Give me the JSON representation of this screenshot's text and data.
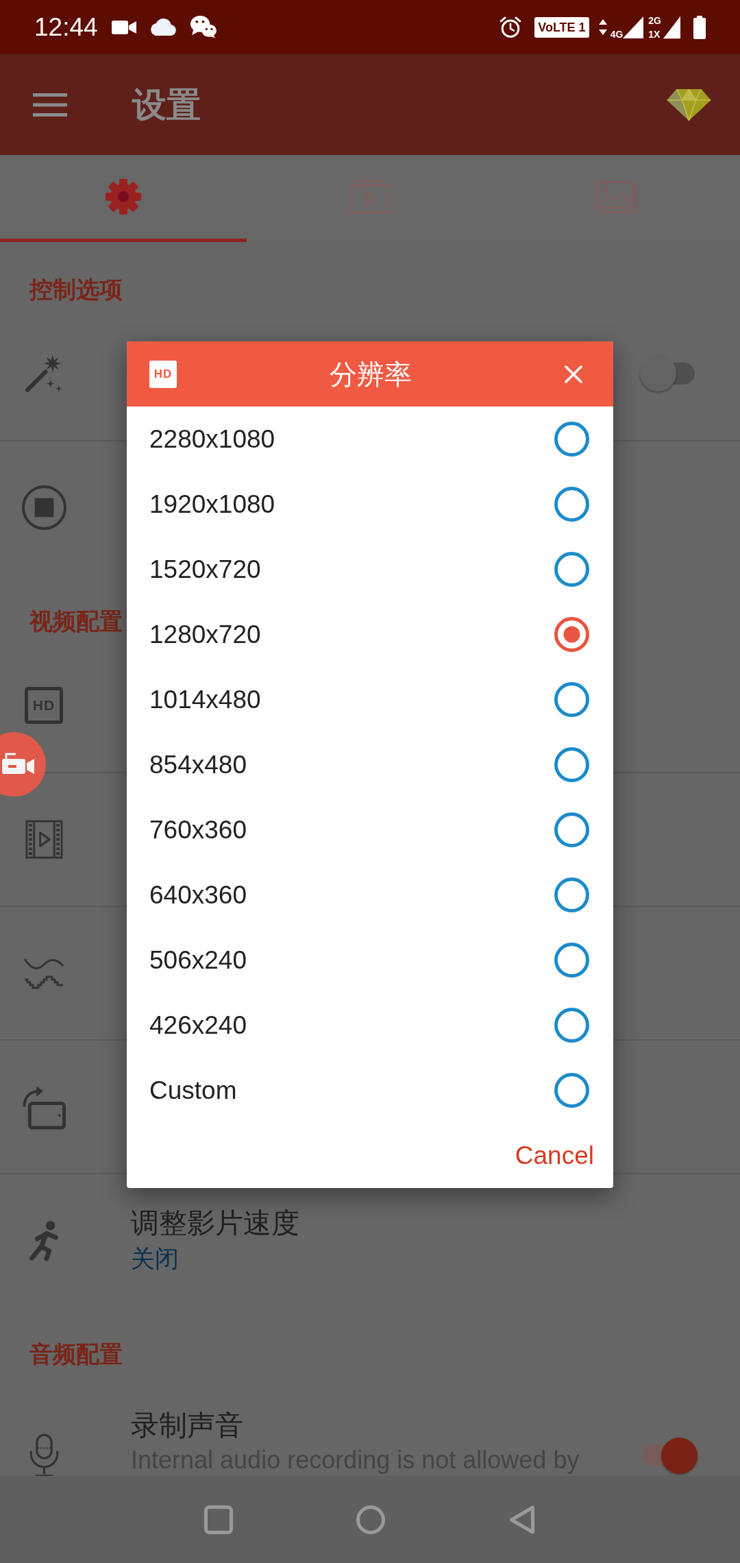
{
  "status_bar": {
    "time": "12:44",
    "volte": "VoLTE 1",
    "network_primary": "4G",
    "network_secondary": [
      "2G",
      "1X"
    ]
  },
  "app_bar": {
    "title": "设置"
  },
  "tabs": [
    {
      "kind": "settings",
      "selected": true
    },
    {
      "kind": "video",
      "selected": false
    },
    {
      "kind": "image",
      "selected": false
    }
  ],
  "settings": [
    {
      "kind": "header",
      "text": "控制选项"
    },
    {
      "kind": "row",
      "switch_on": false
    },
    {
      "kind": "row"
    },
    {
      "kind": "header",
      "text": "视频配置"
    },
    {
      "kind": "row",
      "badge": "HD"
    },
    {
      "kind": "row"
    },
    {
      "kind": "row"
    },
    {
      "kind": "row"
    },
    {
      "kind": "row",
      "title": "调整影片速度",
      "value": "关闭"
    },
    {
      "kind": "header",
      "text": "音频配置"
    },
    {
      "kind": "row",
      "title": "录制声音",
      "summary": "Internal audio recording is not allowed by",
      "switch_on": true
    }
  ],
  "dialog": {
    "badge": "HD",
    "title": "分辨率",
    "options": [
      {
        "label": "2280x1080",
        "selected": false
      },
      {
        "label": "1920x1080",
        "selected": false
      },
      {
        "label": "1520x720",
        "selected": false
      },
      {
        "label": "1280x720",
        "selected": true
      },
      {
        "label": "1014x480",
        "selected": false
      },
      {
        "label": "854x480",
        "selected": false
      },
      {
        "label": "760x360",
        "selected": false
      },
      {
        "label": "640x360",
        "selected": false
      },
      {
        "label": "506x240",
        "selected": false
      },
      {
        "label": "426x240",
        "selected": false
      },
      {
        "label": "Custom",
        "selected": false
      }
    ],
    "cancel": "Cancel"
  }
}
